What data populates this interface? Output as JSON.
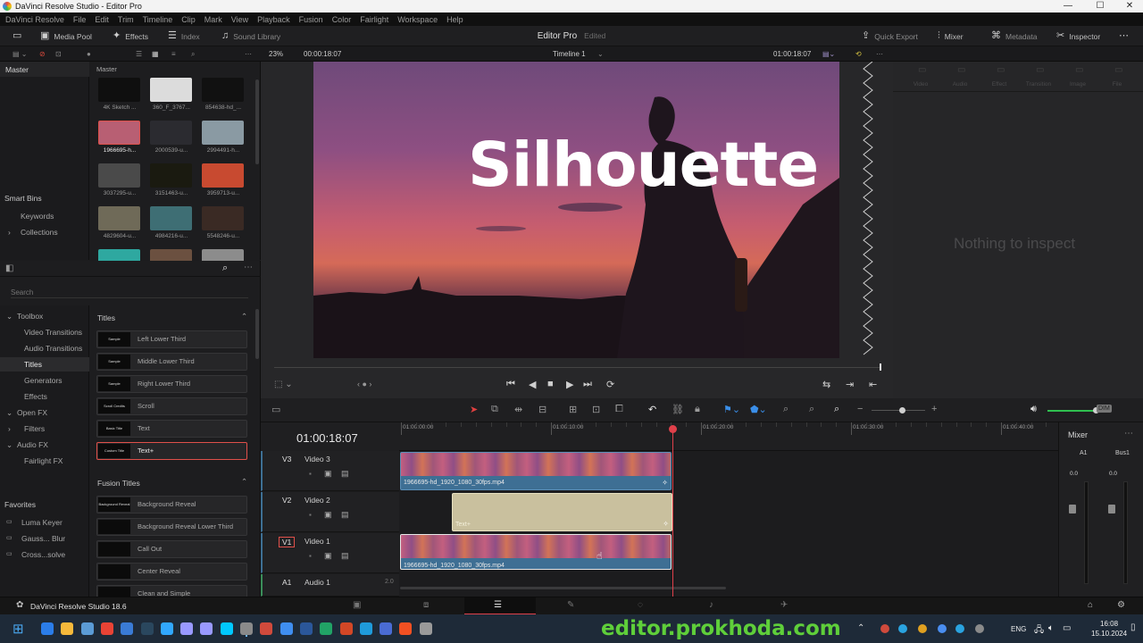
{
  "window": {
    "title": "DaVinci Resolve Studio - Editor Pro",
    "min": "—",
    "max": "☐",
    "close": "✕"
  },
  "menu": [
    "DaVinci Resolve",
    "File",
    "Edit",
    "Trim",
    "Timeline",
    "Clip",
    "Mark",
    "View",
    "Playback",
    "Fusion",
    "Color",
    "Fairlight",
    "Workspace",
    "Help"
  ],
  "toolbar": {
    "media_pool": "Media Pool",
    "effects": "Effects",
    "index": "Index",
    "sound_library": "Sound Library",
    "project": "Editor Pro",
    "status": "Edited",
    "quick_export": "Quick Export",
    "mixer": "Mixer",
    "metadata": "Metadata",
    "inspector": "Inspector"
  },
  "subbar": {
    "zoom": "23%",
    "source_tc": "00:00:18:07",
    "timeline": "Timeline 1",
    "record_tc": "01:00:18:07"
  },
  "mediapool": {
    "bin_header": "Master",
    "grid_header": "Master",
    "smart_bins": "Smart Bins",
    "keywords": "Keywords",
    "collections": "Collections",
    "clips": [
      {
        "label": "4K Sketch ...",
        "color": "#0f0f0f"
      },
      {
        "label": "360_F_3767...",
        "color": "#dcdcdc"
      },
      {
        "label": "854638-hd_...",
        "color": "#111111"
      },
      {
        "label": "1966695-h...",
        "color": "#b85f73"
      },
      {
        "label": "2000539-u...",
        "color": "#2b2b30"
      },
      {
        "label": "2994491-h...",
        "color": "#8a9aa3"
      },
      {
        "label": "3037295-u...",
        "color": "#4a4a4a"
      },
      {
        "label": "3151463-u...",
        "color": "#1a1a10"
      },
      {
        "label": "3959713-u...",
        "color": "#c84a30"
      },
      {
        "label": "4829604-u...",
        "color": "#6f6a58"
      },
      {
        "label": "4984216-u...",
        "color": "#3e6e74"
      },
      {
        "label": "5548246-u...",
        "color": "#3a2a24"
      },
      {
        "label": "",
        "color": "#2ea8a0"
      },
      {
        "label": "",
        "color": "#6b5040"
      },
      {
        "label": "",
        "color": "#8c8c8c"
      }
    ]
  },
  "effects": {
    "search_placeholder": "Search",
    "tree": [
      "Toolbox",
      "Video Transitions",
      "Audio Transitions",
      "Titles",
      "Generators",
      "Effects",
      "Open FX",
      "Filters",
      "Audio FX",
      "Fairlight FX"
    ],
    "favorites": "Favorites",
    "fav_items": [
      "Luma Keyer",
      "Gauss... Blur",
      "Cross...solve"
    ],
    "titles_header": "Titles",
    "titles": [
      {
        "thumb": "Sample",
        "label": "Left Lower Third"
      },
      {
        "thumb": "Sample",
        "label": "Middle Lower Third"
      },
      {
        "thumb": "Sample",
        "label": "Right Lower Third"
      },
      {
        "thumb": "Scroll Credits",
        "label": "Scroll"
      },
      {
        "thumb": "Basic Title",
        "label": "Text"
      },
      {
        "thumb": "Custom Title",
        "label": "Text+"
      }
    ],
    "fusion_header": "Fusion Titles",
    "fusion": [
      {
        "thumb": "Background Reveal",
        "label": "Background Reveal"
      },
      {
        "thumb": "",
        "label": "Background Reveal Lower Third"
      },
      {
        "thumb": "",
        "label": "Call Out"
      },
      {
        "thumb": "",
        "label": "Center Reveal"
      },
      {
        "thumb": "",
        "label": "Clean and Simple"
      }
    ]
  },
  "viewer": {
    "overlay_text": "Silhouette",
    "nothing": "Nothing to inspect",
    "inspector_tabs": [
      "Video",
      "Audio",
      "Effect",
      "Transition",
      "Image",
      "File"
    ]
  },
  "timeline": {
    "timecode": "01:00:18:07",
    "ruler": [
      "01:00:00:00",
      "01:00:10:00",
      "01:00:20:00",
      "01:00:30:00",
      "01:00:40:00"
    ],
    "tracks": [
      {
        "id": "V3",
        "name": "Video 3"
      },
      {
        "id": "V2",
        "name": "Video 2"
      },
      {
        "id": "V1",
        "name": "Video 1"
      },
      {
        "id": "A1",
        "name": "Audio 1",
        "level": "2.0"
      }
    ],
    "clip_v3": "1966695-hd_1920_1080_30fps.mp4",
    "clip_v2": "Text+",
    "clip_v1": "1966695-hd_1920_1080_30fps.mp4"
  },
  "mixer": {
    "title": "Mixer",
    "ch1": "A1",
    "ch2": "Bus1",
    "v1": "0.0",
    "v2": "0.0"
  },
  "status": {
    "app": "DaVinci Resolve Studio 18.6"
  },
  "taskbar": {
    "watermark": "editor.prokhoda.com",
    "lang": "ENG",
    "time": "16:08",
    "date": "15.10.2024"
  }
}
